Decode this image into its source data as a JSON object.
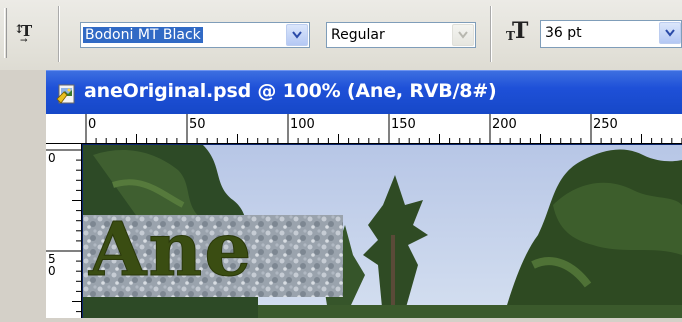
{
  "options_bar": {
    "tool_icon": "text-orientation-icon",
    "font_family": "Bodoni MT Black",
    "font_style": "Regular",
    "font_size_icon": "font-size-icon",
    "font_size": "36 pt"
  },
  "document": {
    "icon": "psd-file-icon",
    "title": "aneOriginal.psd @ 100% (Ane, RVB/8#)",
    "ruler_top_labels": [
      "0",
      "50",
      "100",
      "150",
      "200",
      "250"
    ],
    "ruler_left_labels": [
      "0",
      "5\n0"
    ],
    "text_layer": "Ane",
    "colors": {
      "title_bar": "#1e50d8",
      "text_fill": "#3a4d12",
      "sky": "#c3d2ea",
      "foliage": "#2f4a22"
    }
  }
}
